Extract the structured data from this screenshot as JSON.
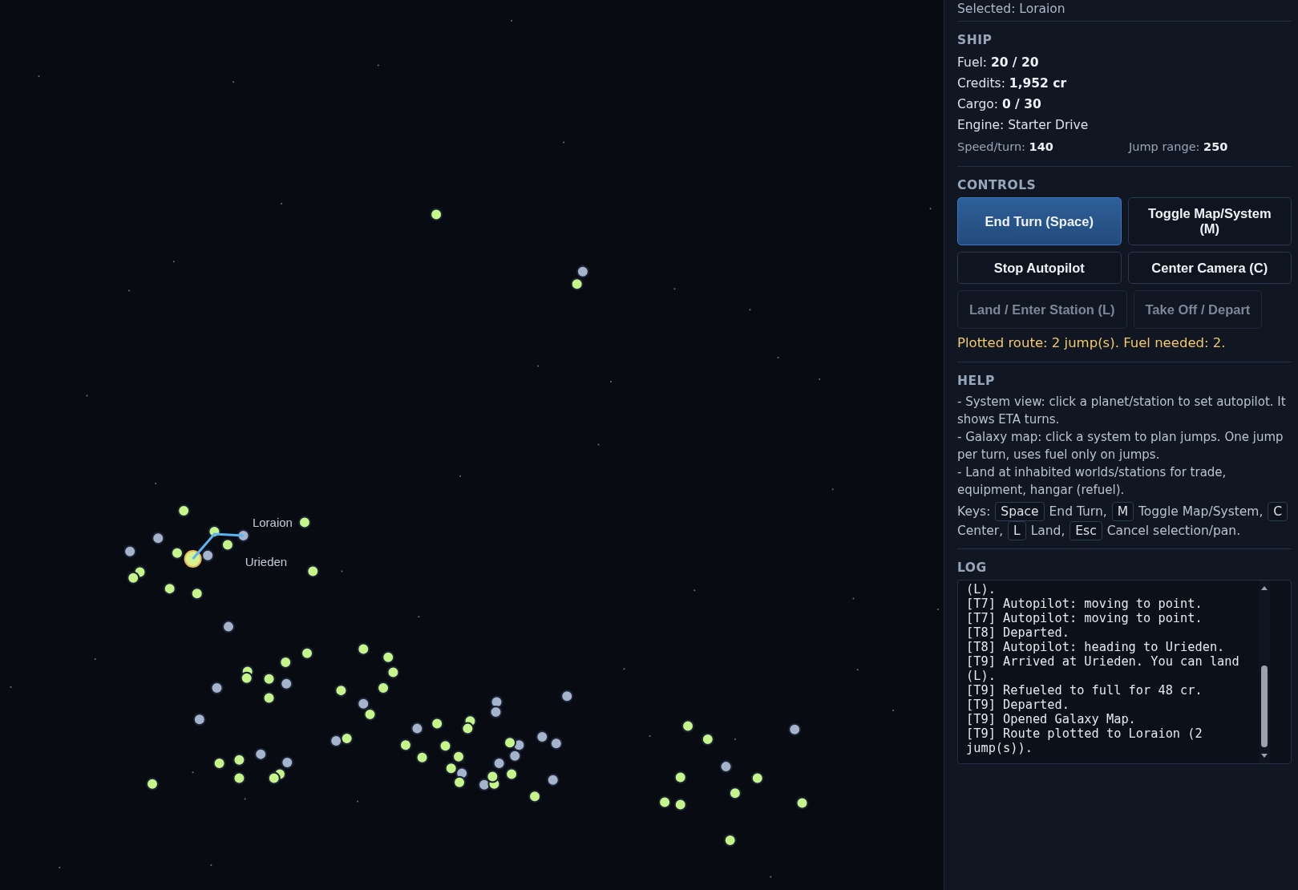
{
  "map": {
    "labels": [
      {
        "text": "Loraion",
        "kind": "target"
      },
      {
        "text": "Urieden",
        "kind": "current"
      }
    ]
  },
  "panel": {
    "selected": "Selected: Loraion",
    "ship": {
      "title": "SHIP",
      "stats": [
        "Fuel: **20 / 20**",
        "Credits: **1,952 cr**",
        "Cargo: **0 / 30**",
        "Engine: Starter Drive"
      ],
      "minor": [
        "Speed/turn: **140**",
        "Jump range: **250**"
      ]
    },
    "controls": {
      "title": "CONTROLS",
      "rows": [
        [
          {
            "label": "End Turn (Space)",
            "primary": true,
            "disabled": false
          },
          {
            "label": "Toggle Map/System (M)",
            "primary": false,
            "disabled": false
          }
        ],
        [
          {
            "label": "Stop Autopilot",
            "primary": false,
            "disabled": false
          },
          {
            "label": "Center Camera (C)",
            "primary": false,
            "disabled": false
          }
        ],
        [
          {
            "label": "Land / Enter Station (L)",
            "primary": false,
            "disabled": true
          },
          {
            "label": "Take Off / Depart",
            "primary": false,
            "disabled": true
          }
        ]
      ],
      "route": "Plotted route: 2 jump(s). Fuel needed: 2."
    },
    "help": {
      "title": "HELP",
      "lines": [
        "- System view: click a planet/station to set autopilot. It shows ETA turns.",
        "- Galaxy map: click a system to plan jumps. One jump per turn, uses fuel only on jumps.",
        "- Land at inhabited worlds/stations for trade, equipment, hangar (refuel)."
      ],
      "keys_prefix": "Keys:",
      "keys": [
        {
          "key": "Space",
          "text": "End Turn,"
        },
        {
          "key": "M",
          "text": "Toggle Map/System,"
        },
        {
          "key": "C",
          "text": "Center,"
        },
        {
          "key": "L",
          "text": "Land,"
        },
        {
          "key": "Esc",
          "text": "Cancel selection/pan."
        }
      ]
    },
    "log": {
      "title": "LOG",
      "entries": [
        "(L).",
        "[T7] Autopilot: moving to point.",
        "[T7] Autopilot: moving to point.",
        "[T8] Departed.",
        "[T8] Autopilot: heading to Urieden.",
        "[T9] Arrived at Urieden. You can land (L).",
        "[T9] Refueled to full for 48 cr.",
        "[T9] Departed.",
        "[T9] Opened Galaxy Map.",
        "[T9] Route plotted to Loraion (2 jump(s))."
      ]
    }
  }
}
